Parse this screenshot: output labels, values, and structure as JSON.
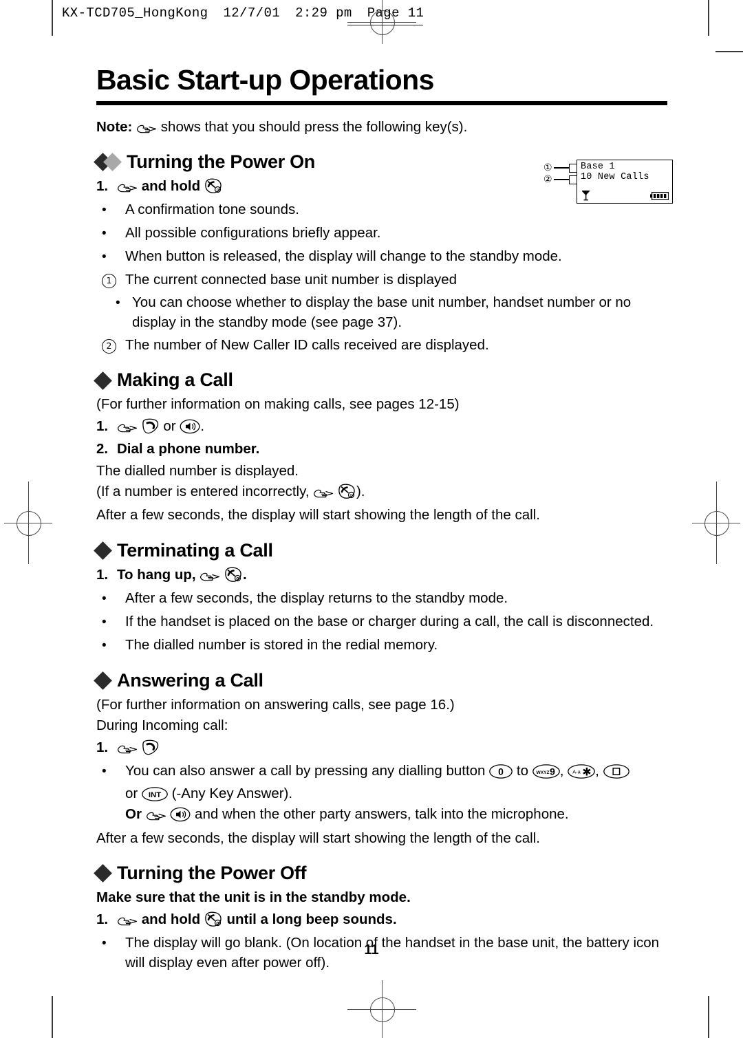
{
  "print_marks": {
    "header_slug": {
      "file": "KX-TCD705_HongKong",
      "date": "12/7/01",
      "time": "2:29 pm",
      "page_label": "Page 11"
    },
    "page_number": "11"
  },
  "document": {
    "title": "Basic Start-up Operations",
    "note": {
      "label": "Note:",
      "icon": "pointing-hand-icon",
      "text": "shows that you should press the following key(s)."
    },
    "sections": [
      {
        "id": "power-on",
        "heading": "Turning the Power On",
        "diamonds": 2,
        "steps": [
          {
            "num": "1.",
            "pre": "",
            "mid": "and hold",
            "post": ""
          }
        ],
        "bullets": [
          {
            "mark": "dot",
            "text": "A confirmation tone sounds."
          },
          {
            "mark": "dot",
            "text": "All possible configurations briefly appear."
          },
          {
            "mark": "dot",
            "text": "When button is released, the display will change to the standby mode."
          },
          {
            "mark": "circle-1",
            "text": "The current connected base unit number is displayed"
          },
          {
            "mark": "dot-indent",
            "text": "You can choose whether to display the base unit number, handset number or no display in the standby mode (see page 37)."
          },
          {
            "mark": "circle-2",
            "text": "The number of New Caller ID calls received are displayed."
          }
        ]
      },
      {
        "id": "making-a-call",
        "heading": "Making a Call",
        "diamonds": 1,
        "intro": "(For further information on making calls, see pages 12-15)",
        "step1_or": "or",
        "step1_end": ".",
        "step2_label": "Dial a phone number.",
        "step2_line1": "The dialled number is displayed.",
        "step2_line2_open": "(If a number is entered incorrectly,",
        "step2_line2_close": ").",
        "closing": "After a few seconds, the display will start showing the length of the call."
      },
      {
        "id": "terminating-a-call",
        "heading": "Terminating a Call",
        "diamonds": 1,
        "step1_label": "To hang up,",
        "step1_end": ".",
        "bullets": [
          "After a few seconds, the display returns to the standby mode.",
          "If the handset is placed on the base or charger during a call, the call is disconnected.",
          "The dialled number is stored in the redial memory."
        ]
      },
      {
        "id": "answering-a-call",
        "heading": "Answering a Call",
        "diamonds": 1,
        "intro": "(For further information on answering calls, see page 16.)",
        "during": "During Incoming call:",
        "step_num": "1.",
        "bullet_any_key_pre": "You can also answer a call by pressing any dialling button",
        "bullet_any_key_to": "to",
        "bullet_any_key_comma1": ",",
        "bullet_any_key_comma2": ",",
        "any_key_line2_or": "or",
        "any_key_line2_text": "(-Any Key Answer).",
        "or_label": "Or",
        "or_text": "and when the other party answers, talk into the microphone.",
        "closing": "After a few seconds, the display will start showing the length of the call."
      },
      {
        "id": "power-off",
        "heading": "Turning the Power Off",
        "diamonds": 1,
        "standby_note": "Make sure that the unit is in the standby mode.",
        "step_num": "1.",
        "step_pre": "and hold",
        "step_post": "until a long beep sounds.",
        "bullets": [
          "The display will go blank. (On location of the handset in the base unit, the battery icon will display even after power off)."
        ]
      }
    ],
    "keys": {
      "pointing_hand": "pointing-hand-icon",
      "power_off": "power-off-key-icon",
      "talk": "talk-key-icon",
      "speakerphone": "speakerphone-key-icon",
      "int": "INT",
      "digit_0": "0",
      "digit_9": "9",
      "digit_9_letters": "WXYZ",
      "star": "✱",
      "star_letters": "A-a",
      "hash": "hash-key-icon"
    },
    "lcd": {
      "line1": "Base 1",
      "line2": "10 New Calls",
      "callout1": "①",
      "callout2": "②",
      "antenna_icon": "antenna-icon",
      "battery_icon": "battery-icon"
    }
  }
}
